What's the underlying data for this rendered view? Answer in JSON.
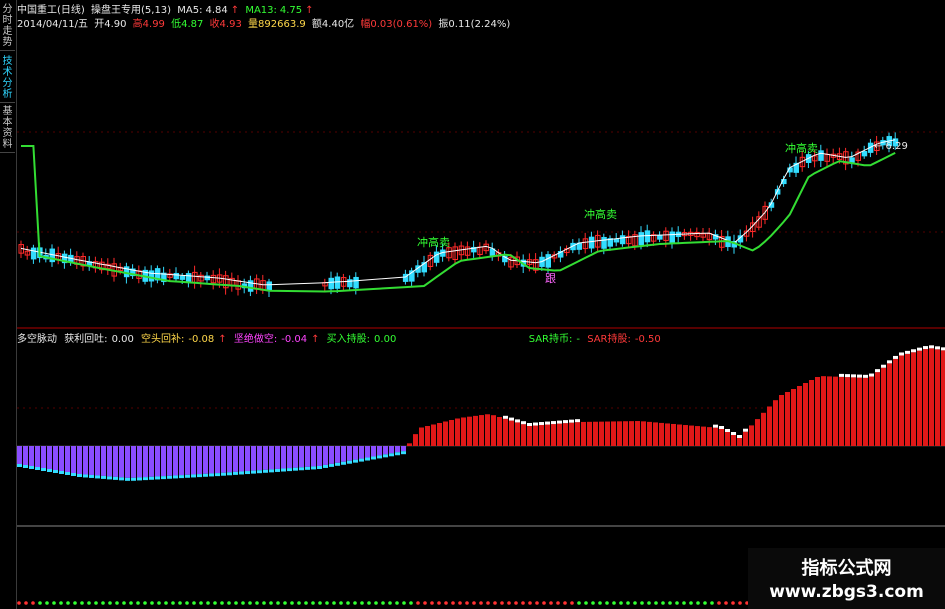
{
  "sidebar": {
    "tabs": [
      {
        "label": "分时走势",
        "active": false
      },
      {
        "label": "技术分析",
        "active": true
      },
      {
        "label": "基本资料",
        "active": false
      }
    ]
  },
  "header": {
    "stock_name": "中国重工(日线)",
    "indicator_name": "操盘王专用(5,13)",
    "ma5_label": "MA5:",
    "ma5_value": "4.84",
    "ma13_label": "MA13:",
    "ma13_value": "4.75",
    "date": "2014/04/11/五",
    "open": "开4.90",
    "high": "高4.99",
    "low": "低4.87",
    "close": "收4.93",
    "volume": "量892663.9",
    "amount": "额4.40亿",
    "change": "幅0.03(0.61%)",
    "amplitude": "振0.11(2.24%)"
  },
  "price_chart": {
    "annotations": [
      "冲高卖",
      "冲高卖",
      "冲高卖",
      "跟"
    ],
    "max_label": "← 6.29",
    "max_value": 6.29
  },
  "oscillator": {
    "title": "多空脉动",
    "profit_label": "获利回吐:",
    "profit_value": "0.00",
    "short_label": "空头回补:",
    "short_value": "-0.08",
    "weak_label": "坚绝做空:",
    "weak_value": "-0.04",
    "buy_label": "买入持股:",
    "buy_value": "0.00",
    "sar_hold_label": "SAR持币:",
    "sar_hold_value": "-",
    "sar_stock_label": "SAR持股:",
    "sar_stock_value": "-0.50"
  },
  "colors": {
    "up": "#ff2a2a",
    "down": "#33ddff",
    "ma_fast": "#ffffff",
    "ma_slow": "#33dd33",
    "osc_pos": "#e01818",
    "osc_neg": "#8a4dff",
    "osc_neg_light": "#33ddff"
  },
  "watermark": {
    "line1": "指标公式网",
    "line2": "www.zbgs3.com"
  }
}
